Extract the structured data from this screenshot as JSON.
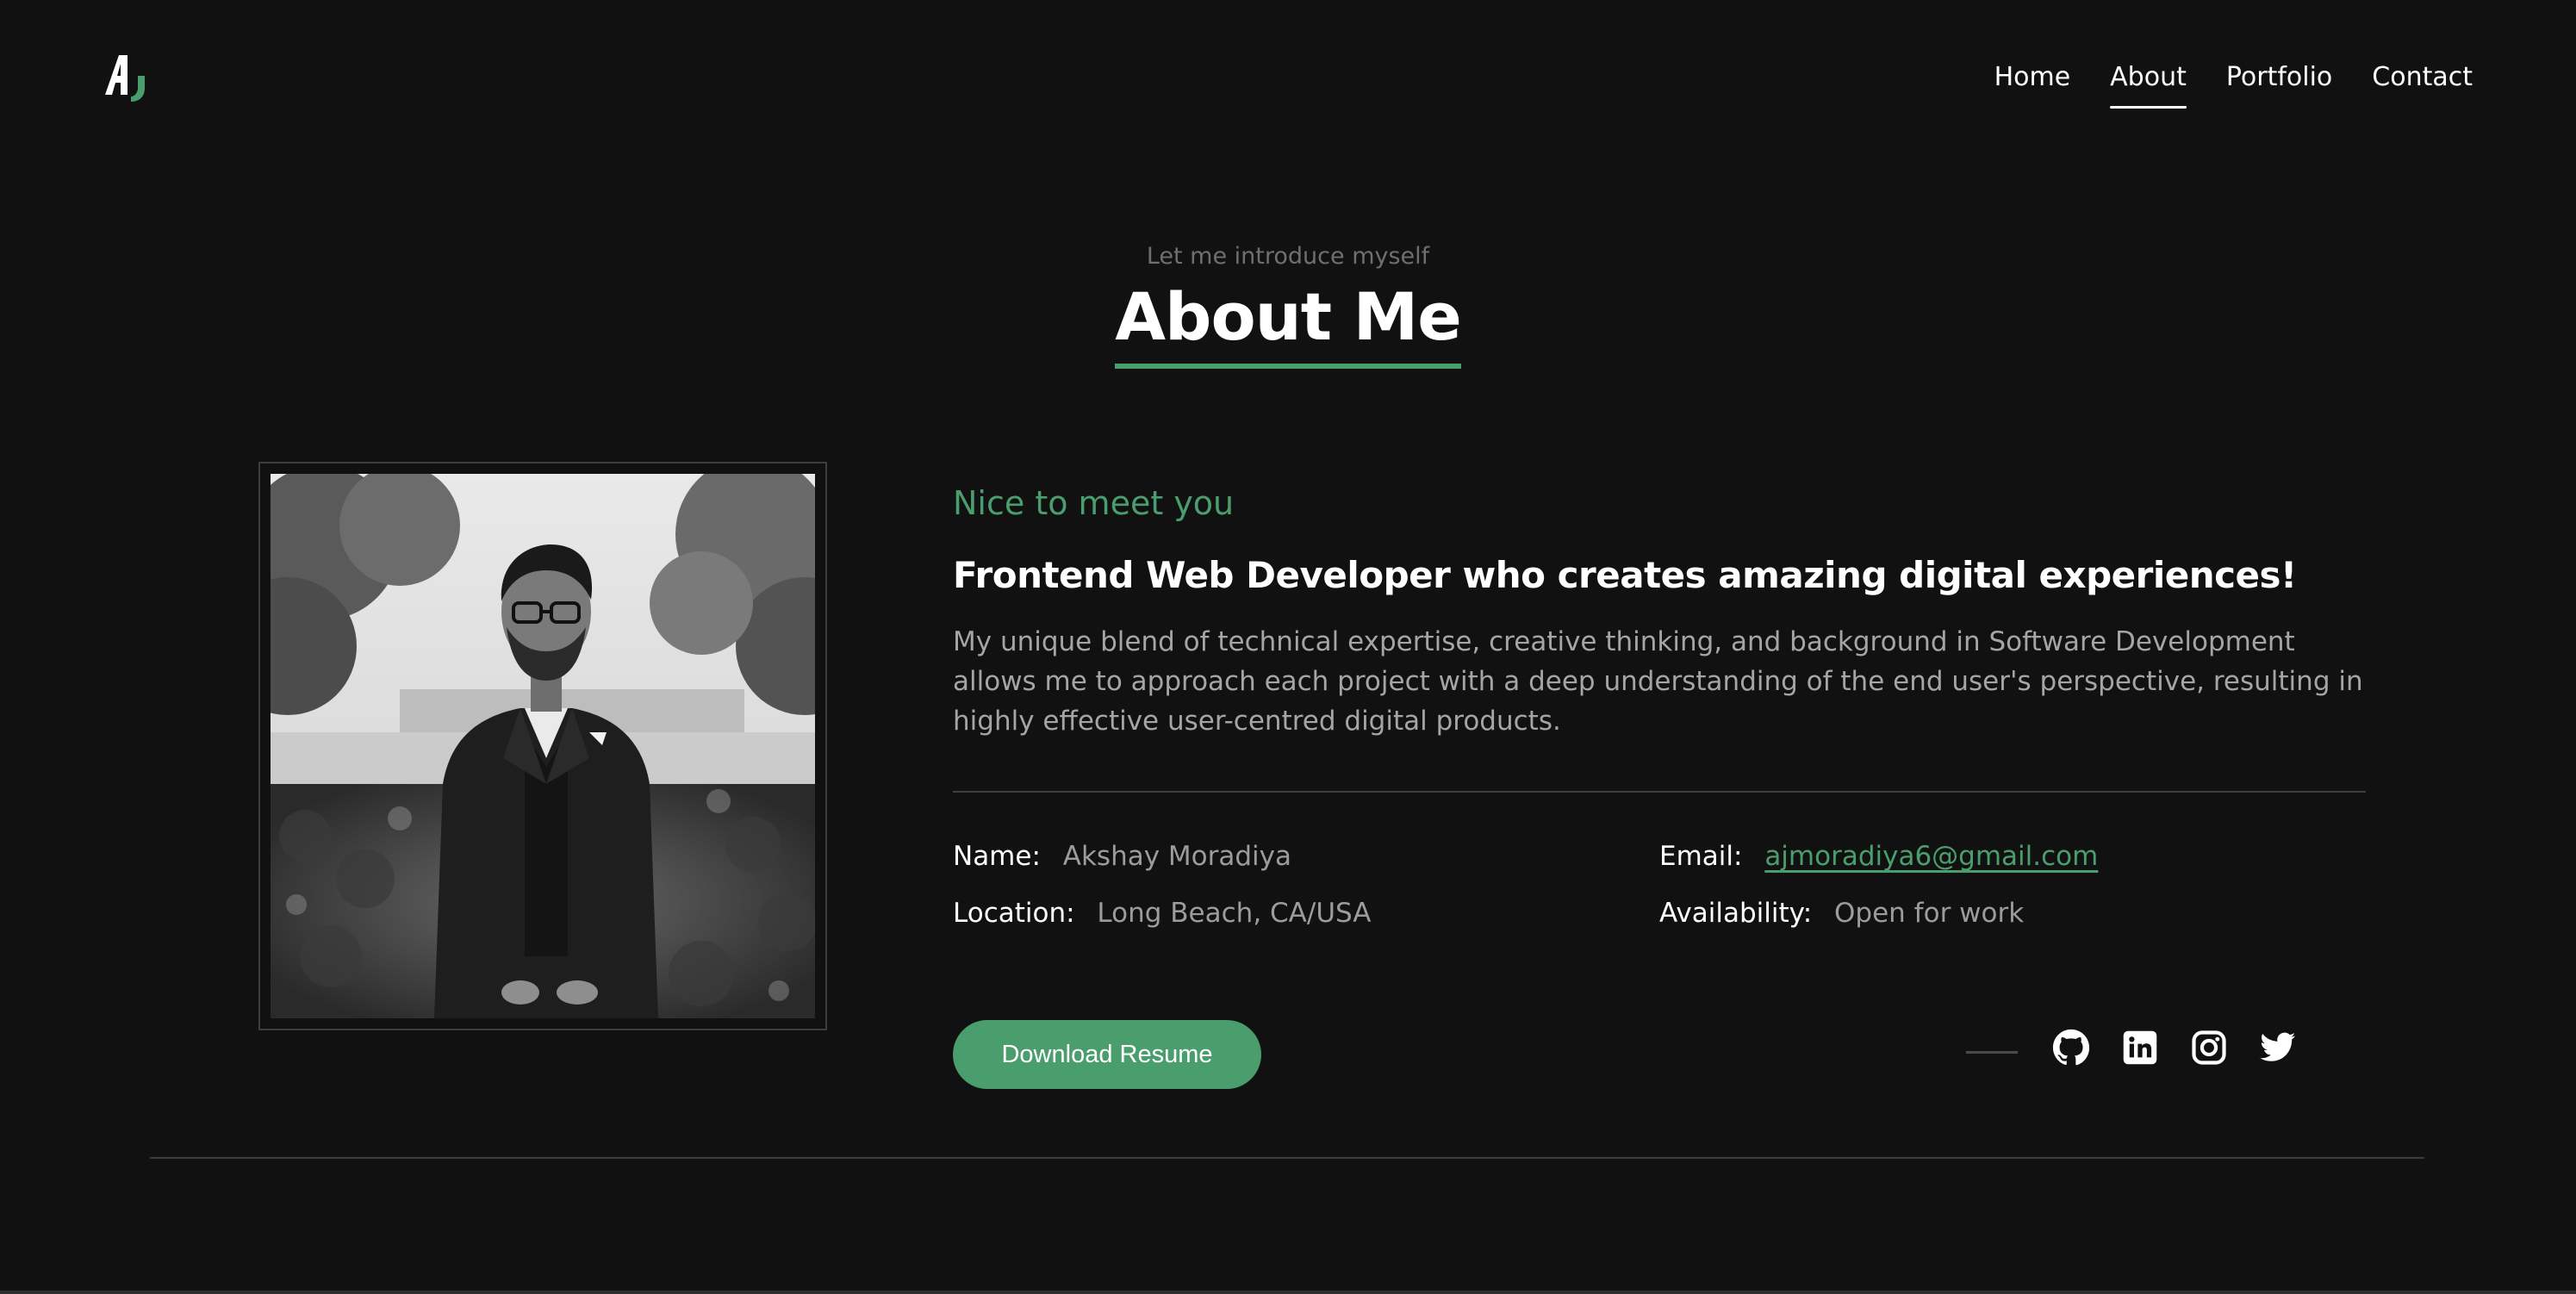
{
  "header": {
    "logo_alt": "AJ logo",
    "nav": [
      {
        "label": "Home",
        "active": false
      },
      {
        "label": "About",
        "active": true
      },
      {
        "label": "Portfolio",
        "active": false
      },
      {
        "label": "Contact",
        "active": false
      }
    ]
  },
  "about": {
    "intro": "Let me introduce myself",
    "title": "About Me",
    "greeting": "Nice to meet you",
    "tagline": "Frontend Web Developer who creates amazing digital experiences!",
    "bio": "My unique blend of technical expertise, creative thinking, and background in Software Development allows me to approach each project with a deep understanding of the end user's perspective, resulting in highly effective user-centred digital products.",
    "details": {
      "name_label": "Name:",
      "name_value": "Akshay Moradiya",
      "email_label": "Email:",
      "email_value": "ajmoradiya6@gmail.com",
      "location_label": "Location:",
      "location_value": "Long Beach, CA/USA",
      "availability_label": "Availability:",
      "availability_value": "Open for work"
    },
    "resume_button": "Download Resume",
    "social": [
      "github-icon",
      "linkedin-icon",
      "instagram-icon",
      "twitter-icon"
    ]
  },
  "colors": {
    "background": "#111111",
    "accent": "#4a9e6e",
    "muted_text": "#a5a5a5",
    "divider": "#3e3e3e"
  }
}
